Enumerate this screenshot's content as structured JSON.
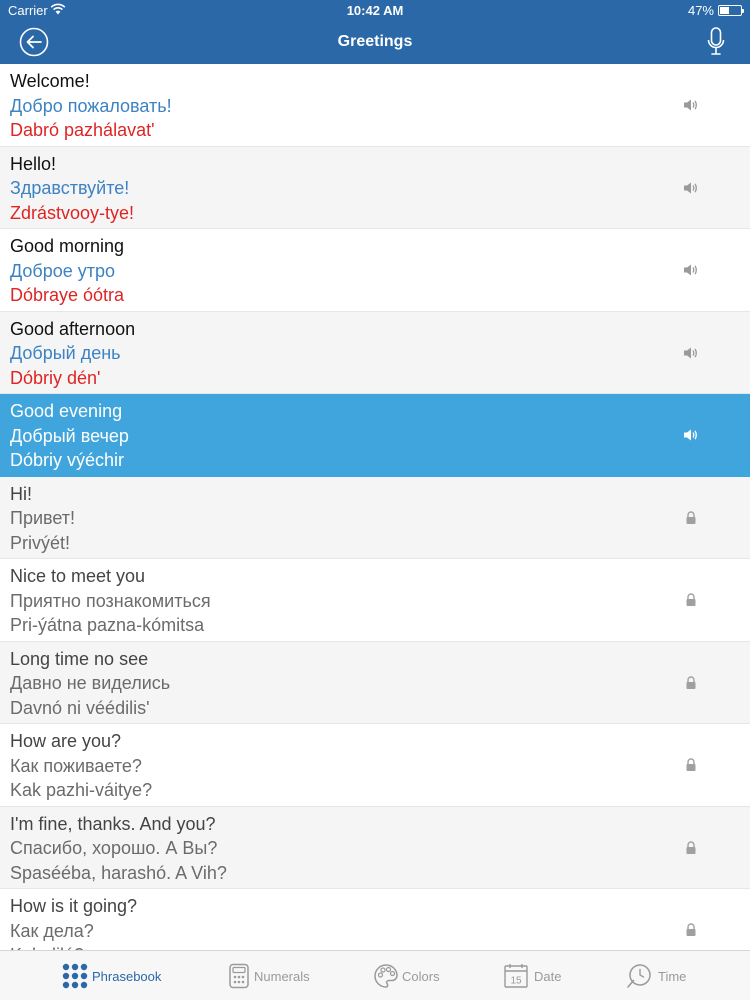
{
  "status_bar": {
    "carrier": "Carrier",
    "time": "10:42 AM",
    "battery": "47%",
    "battery_level": 0.47
  },
  "nav": {
    "title": "Greetings"
  },
  "phrases": [
    {
      "en": "Welcome!",
      "ru": "Добро пожаловать!",
      "tr": "Dabró pazhálavat'",
      "state": "sound"
    },
    {
      "en": "Hello!",
      "ru": "Здравствуйте!",
      "tr": "Zdrástvooy-tye!",
      "state": "sound"
    },
    {
      "en": "Good morning",
      "ru": "Доброе утро",
      "tr": "Dóbraye óótra",
      "state": "sound"
    },
    {
      "en": "Good afternoon",
      "ru": "Добрый день",
      "tr": "Dóbriy dén'",
      "state": "sound"
    },
    {
      "en": "Good evening",
      "ru": "Добрый вечер",
      "tr": "Dóbriy výéchir",
      "state": "selected"
    },
    {
      "en": "Hi!",
      "ru": "Привет!",
      "tr": "Privýét!",
      "state": "locked"
    },
    {
      "en": "Nice to meet you",
      "ru": "Приятно познакомиться",
      "tr": "Pri-ýátna pazna-kómitsa",
      "state": "locked"
    },
    {
      "en": "Long time no see",
      "ru": "Давно не виделись",
      "tr": "Davnó ni véédilis'",
      "state": "locked"
    },
    {
      "en": "How are you?",
      "ru": "Как поживаете?",
      "tr": "Kak pazhi-váitye?",
      "state": "locked"
    },
    {
      "en": "I'm fine, thanks. And you?",
      "ru": "Спасибо, хорошо. А Вы?",
      "tr": "Spaséé­ba, harashó. A Vih?",
      "state": "locked"
    },
    {
      "en": "How is it going?",
      "ru": "Как дела?",
      "tr": "Kak diló?",
      "state": "locked"
    }
  ],
  "tabs": [
    {
      "label": "Phrasebook",
      "icon": "phrasebook-grid-icon",
      "active": true
    },
    {
      "label": "Numerals",
      "icon": "calculator-icon",
      "active": false
    },
    {
      "label": "Colors",
      "icon": "palette-icon",
      "active": false
    },
    {
      "label": "Date",
      "icon": "calendar-icon",
      "active": false,
      "icon_text": "15"
    },
    {
      "label": "Time",
      "icon": "clock-icon",
      "active": false
    }
  ],
  "colors": {
    "bar": "#2a68a8",
    "selected_row": "#3fa5dc",
    "russian": "#3c82c4",
    "transliteration": "#e02424",
    "active_tab": "#2a68a8",
    "inactive_tab": "#9a9a9a"
  }
}
